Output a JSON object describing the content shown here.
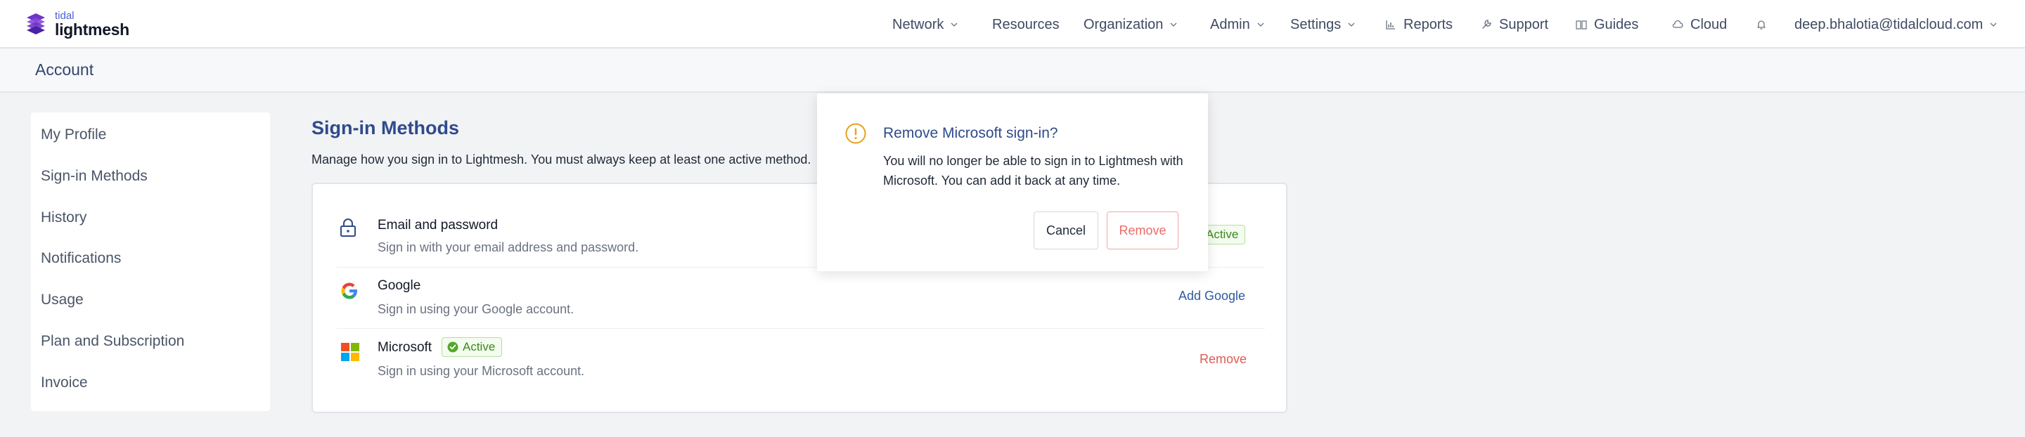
{
  "brand": {
    "small": "tidal",
    "big": "lightmesh"
  },
  "nav": {
    "network": "Network",
    "resources": "Resources",
    "organization": "Organization",
    "admin": "Admin",
    "settings": "Settings",
    "reports": "Reports",
    "support": "Support",
    "guides": "Guides",
    "cloud": "Cloud",
    "user": "deep.bhalotia@tidalcloud.com"
  },
  "page": {
    "title": "Account"
  },
  "sidebar": {
    "items": [
      {
        "label": "My Profile"
      },
      {
        "label": "Sign-in Methods"
      },
      {
        "label": "History"
      },
      {
        "label": "Notifications"
      },
      {
        "label": "Usage"
      },
      {
        "label": "Plan and Subscription"
      },
      {
        "label": "Invoice"
      }
    ]
  },
  "main": {
    "title": "Sign-in Methods",
    "description": "Manage how you sign in to Lightmesh. You must always keep at least one active method.",
    "methods": [
      {
        "icon": "lock-icon",
        "title": "Email and password",
        "subtitle": "Sign in with your email address and password.",
        "badge": "Active",
        "action": ""
      },
      {
        "icon": "google-icon",
        "title": "Google",
        "subtitle": "Sign in using your Google account.",
        "badge": "",
        "action": "Add Google"
      },
      {
        "icon": "microsoft-icon",
        "title": "Microsoft",
        "subtitle": "Sign in using your Microsoft account.",
        "badge": "Active",
        "action": "Remove"
      }
    ]
  },
  "dialog": {
    "title": "Remove Microsoft sign-in?",
    "body": "You will no longer be able to sign in to Lightmesh with Microsoft. You can add it back at any time.",
    "cancel": "Cancel",
    "confirm": "Remove"
  },
  "colors": {
    "accent": "#2f4b8a",
    "link": "#2f5aa0",
    "danger": "#e05a55",
    "active_green": "#3b8a1d",
    "warning": "#e8a21a"
  }
}
